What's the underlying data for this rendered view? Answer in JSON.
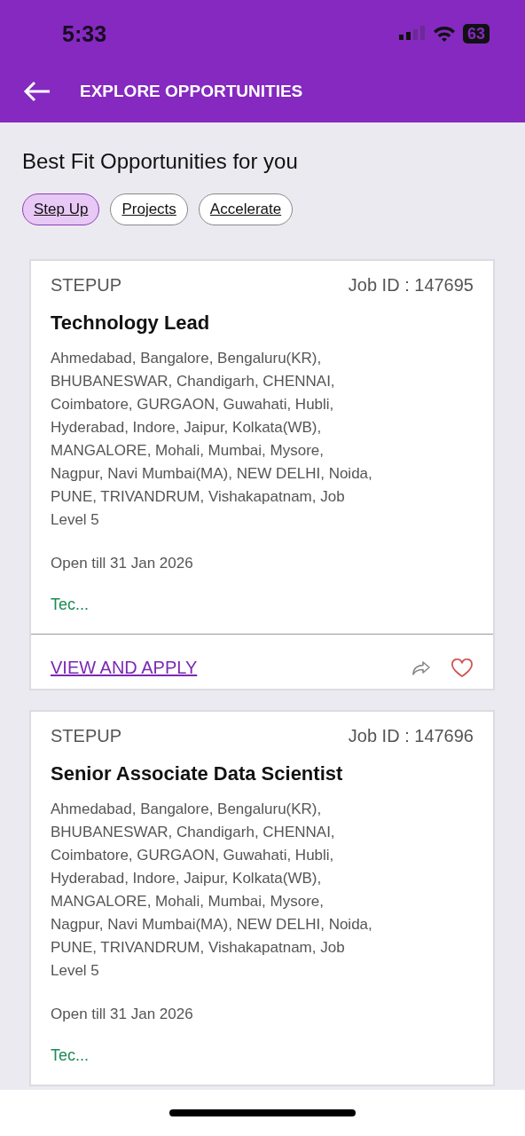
{
  "status_bar": {
    "time": "5:33",
    "battery": "63"
  },
  "header": {
    "title": "EXPLORE OPPORTUNITIES"
  },
  "section_title": "Best Fit Opportunities for you",
  "filters": [
    {
      "label": "Step Up",
      "selected": true
    },
    {
      "label": "Projects",
      "selected": false
    },
    {
      "label": "Accelerate",
      "selected": false
    }
  ],
  "jobs": [
    {
      "type": "STEPUP",
      "job_id": "Job ID : 147695",
      "title": "Technology Lead",
      "locations": "Ahmedabad, Bangalore, Bengaluru(KR), BHUBANESWAR, Chandigarh, CHENNAI, Coimbatore, GURGAON, Guwahati, Hubli, Hyderabad, Indore, Jaipur, Kolkata(WB), MANGALORE, Mohali, Mumbai, Mysore, Nagpur, Navi Mumbai(MA), NEW DELHI, Noida, PUNE, TRIVANDRUM, Vishakapatnam, Job Level 5",
      "open_till": "Open till 31 Jan 2026",
      "skills": "Tec...",
      "action": "VIEW AND APPLY",
      "favorite": false
    },
    {
      "type": "STEPUP",
      "job_id": "Job ID : 147696",
      "title": "Senior Associate Data Scientist",
      "locations": "Ahmedabad, Bangalore, Bengaluru(KR), BHUBANESWAR, Chandigarh, CHENNAI, Coimbatore, GURGAON, Guwahati, Hubli, Hyderabad, Indore, Jaipur, Kolkata(WB), MANGALORE, Mohali, Mumbai, Mysore, Nagpur, Navi Mumbai(MA), NEW DELHI, Noida, PUNE, TRIVANDRUM, Vishakapatnam, Job Level 5",
      "open_till": "Open till 31 Jan 2026",
      "skills": "Tec..."
    }
  ]
}
